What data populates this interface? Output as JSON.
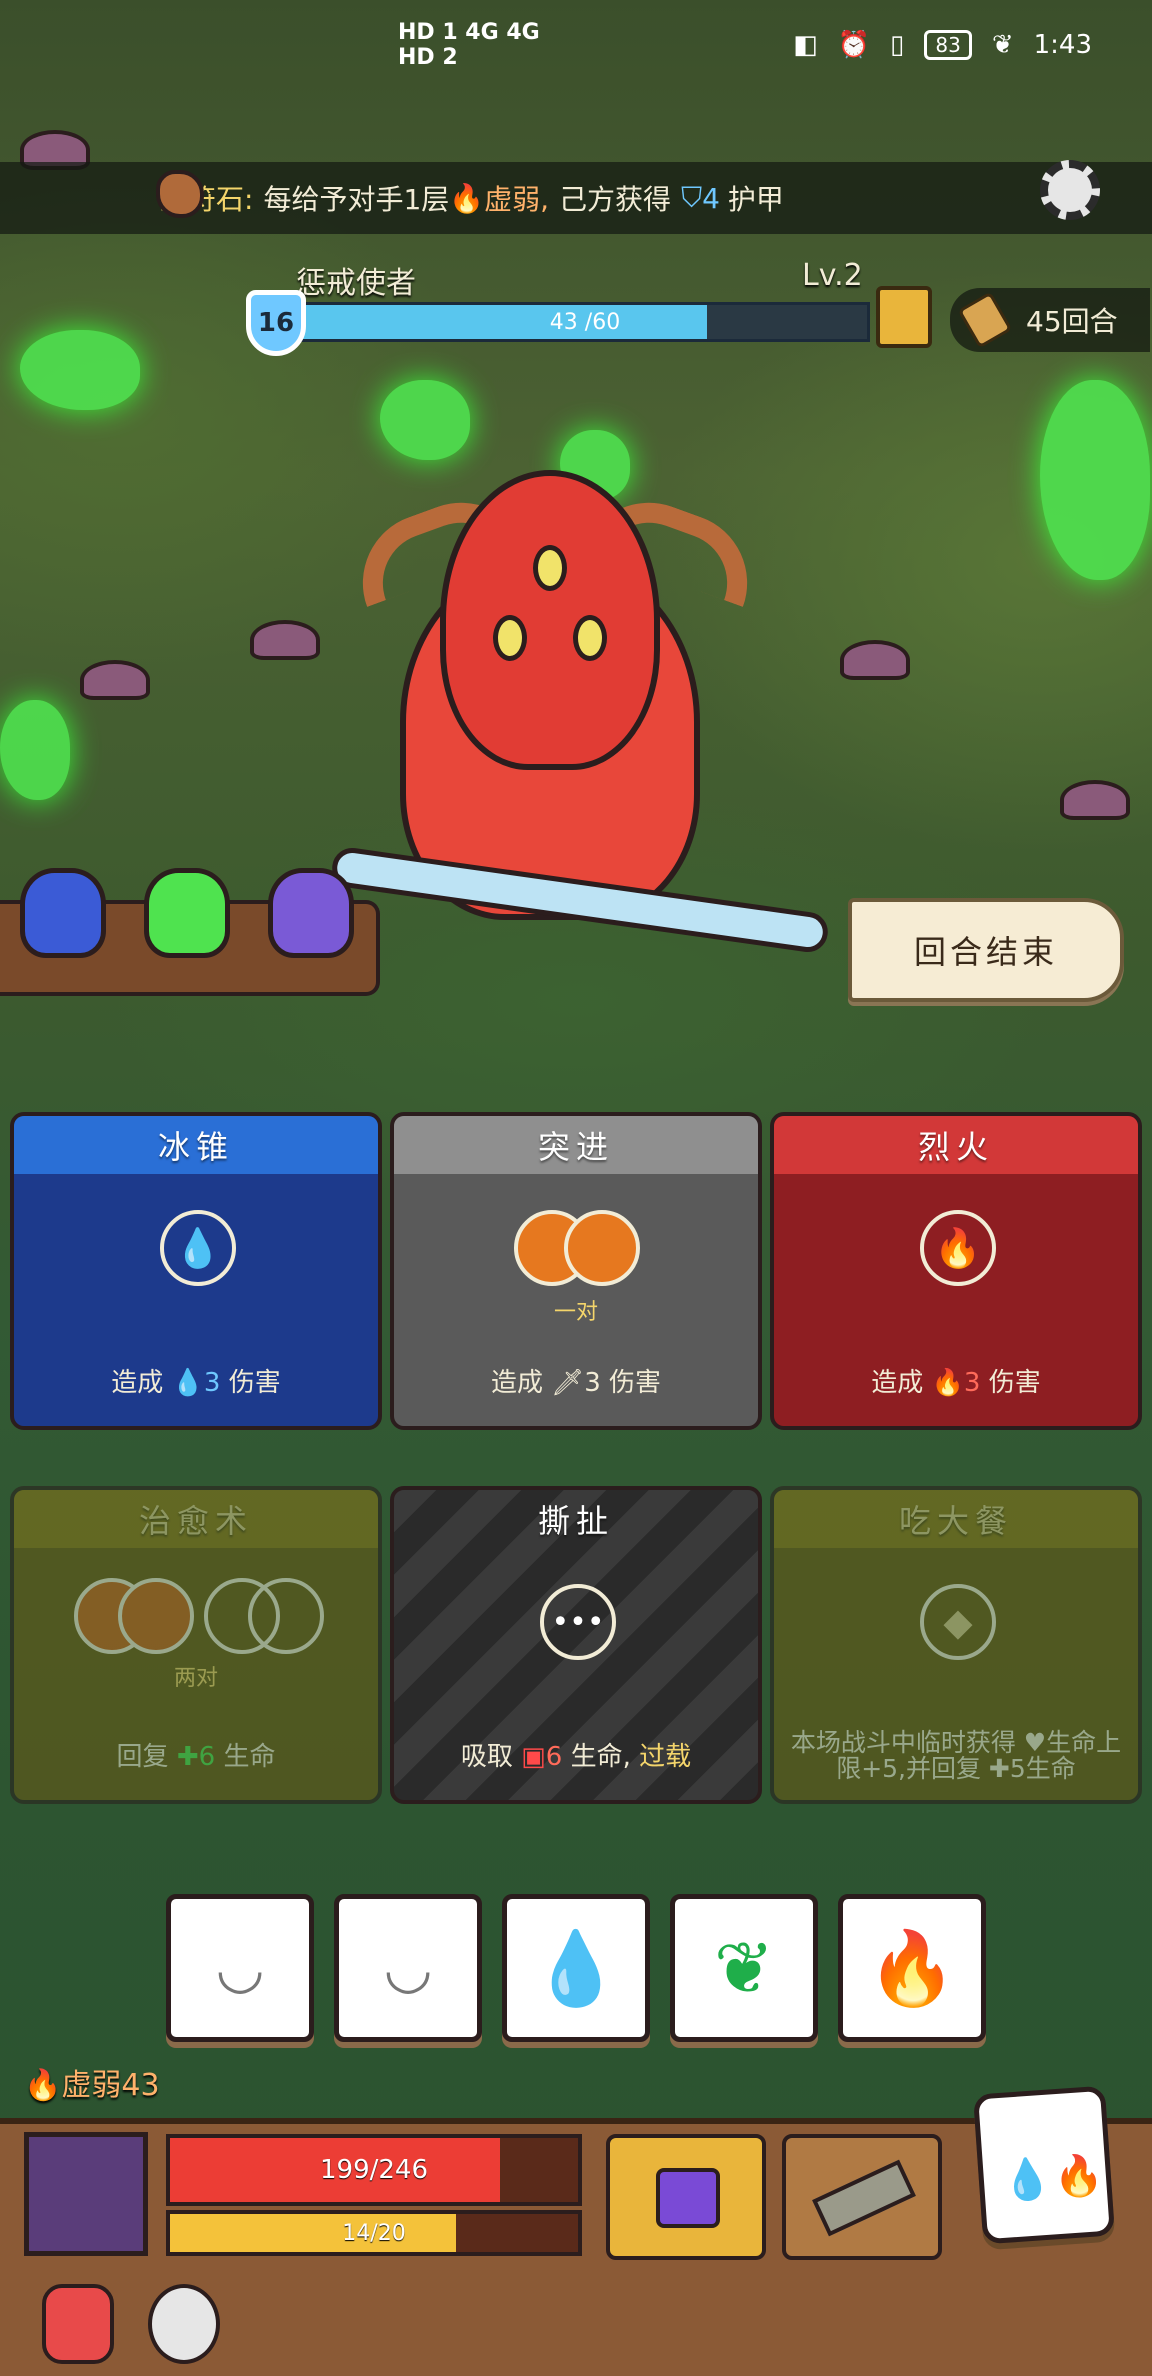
{
  "status_bar": {
    "network_left": "HD 1 4G  4G",
    "network_left2": "HD 2",
    "battery": "83",
    "time": "1:43"
  },
  "rune_banner": {
    "name": "土符石:",
    "text_before": "每给予对手1层",
    "effect": "虚弱,",
    "text_after": "己方获得",
    "shield_amount": "4",
    "shield_label": "护甲"
  },
  "enemy": {
    "name": "惩戒使者",
    "level": "Lv.2",
    "shield": "16",
    "hp_text": "43 /60",
    "hp_current": 43,
    "hp_max": 60
  },
  "rounds": "45回合",
  "end_turn_label": "回合结束",
  "cards": [
    {
      "title": "冰锥",
      "desc_pre": "造成",
      "desc_num": "3",
      "desc_post": "伤害",
      "theme": "blue",
      "slot_icon": "water-drop-icon"
    },
    {
      "title": "突进",
      "sub": "一对",
      "desc_pre": "造成",
      "desc_num": "3",
      "desc_post": "伤害",
      "theme": "gray",
      "slot_icon": "pair-slots-icon"
    },
    {
      "title": "烈火",
      "desc_pre": "造成",
      "desc_num": "3",
      "desc_post": "伤害",
      "theme": "red",
      "slot_icon": "fire-icon"
    },
    {
      "title": "治愈术",
      "sub": "两对",
      "desc_pre": "回复",
      "desc_num": "6",
      "desc_post": "生命",
      "theme": "olive",
      "slot_icon": "two-pairs-icon"
    },
    {
      "title": "撕扯",
      "desc_pre": "吸取",
      "desc_num": "6",
      "desc_mid": "生命,",
      "desc_hl": "过载",
      "theme": "striped",
      "slot_icon": "any-dice-icon"
    },
    {
      "title": "吃大餐",
      "desc": "本场战斗中临时获得 ♥生命上限+5,并回复 ✚5生命",
      "theme": "olive",
      "slot_icon": "diamond-icon"
    }
  ],
  "dice": [
    {
      "face": "closed-eye-icon"
    },
    {
      "face": "closed-eye-icon"
    },
    {
      "face": "water-drop-icon"
    },
    {
      "face": "leaf-icon"
    },
    {
      "face": "fire-icon"
    }
  ],
  "player": {
    "weak_status": "虚弱43",
    "hp_text": "199/246",
    "hp_current": 199,
    "hp_max": 246,
    "mana_text": "14/20",
    "mana_current": 14,
    "mana_max": 20
  },
  "colors": {
    "ice": "#1d3a8c",
    "ice_header": "#2a6fd6",
    "gray": "#5a5a5a",
    "gray_header": "#8f8f8f",
    "fire": "#8e1e22",
    "fire_header": "#d23838",
    "olive": "#6b5a14",
    "olive_header": "#8c7616"
  }
}
